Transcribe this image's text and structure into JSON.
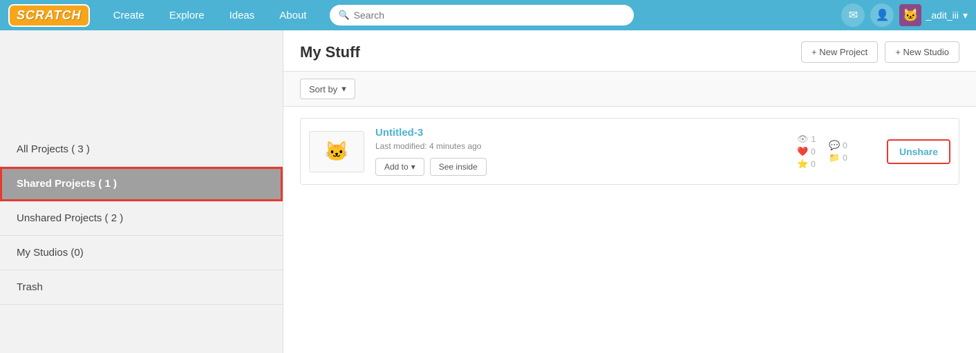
{
  "header": {
    "logo": "SCRATCH",
    "nav": [
      {
        "label": "Create",
        "id": "create"
      },
      {
        "label": "Explore",
        "id": "explore"
      },
      {
        "label": "Ideas",
        "id": "ideas"
      },
      {
        "label": "About",
        "id": "about"
      }
    ],
    "search_placeholder": "Search",
    "new_project_label": "+ New Project",
    "new_studio_label": "+ New Studio",
    "username": "_adit_iii"
  },
  "page_title": "My Stuff",
  "sort_label": "Sort by",
  "sidebar": {
    "items": [
      {
        "label": "All Projects ( 3 )",
        "id": "all-projects",
        "active": false
      },
      {
        "label": "Shared Projects ( 1 )",
        "id": "shared-projects",
        "active": true
      },
      {
        "label": "Unshared Projects ( 2 )",
        "id": "unshared-projects",
        "active": false
      },
      {
        "label": "My Studios (0)",
        "id": "my-studios",
        "active": false
      },
      {
        "label": "Trash",
        "id": "trash",
        "active": false
      }
    ]
  },
  "projects": [
    {
      "name": "Untitled-3",
      "meta": "Last modified: 4 minutes ago",
      "thumbnail_emoji": "🐱",
      "add_to_label": "Add to",
      "see_inside_label": "See inside",
      "stats": {
        "views": 1,
        "loves": 0,
        "favorites": 0,
        "comments": 0,
        "remixes": 0
      },
      "unshare_label": "Unshare"
    }
  ]
}
